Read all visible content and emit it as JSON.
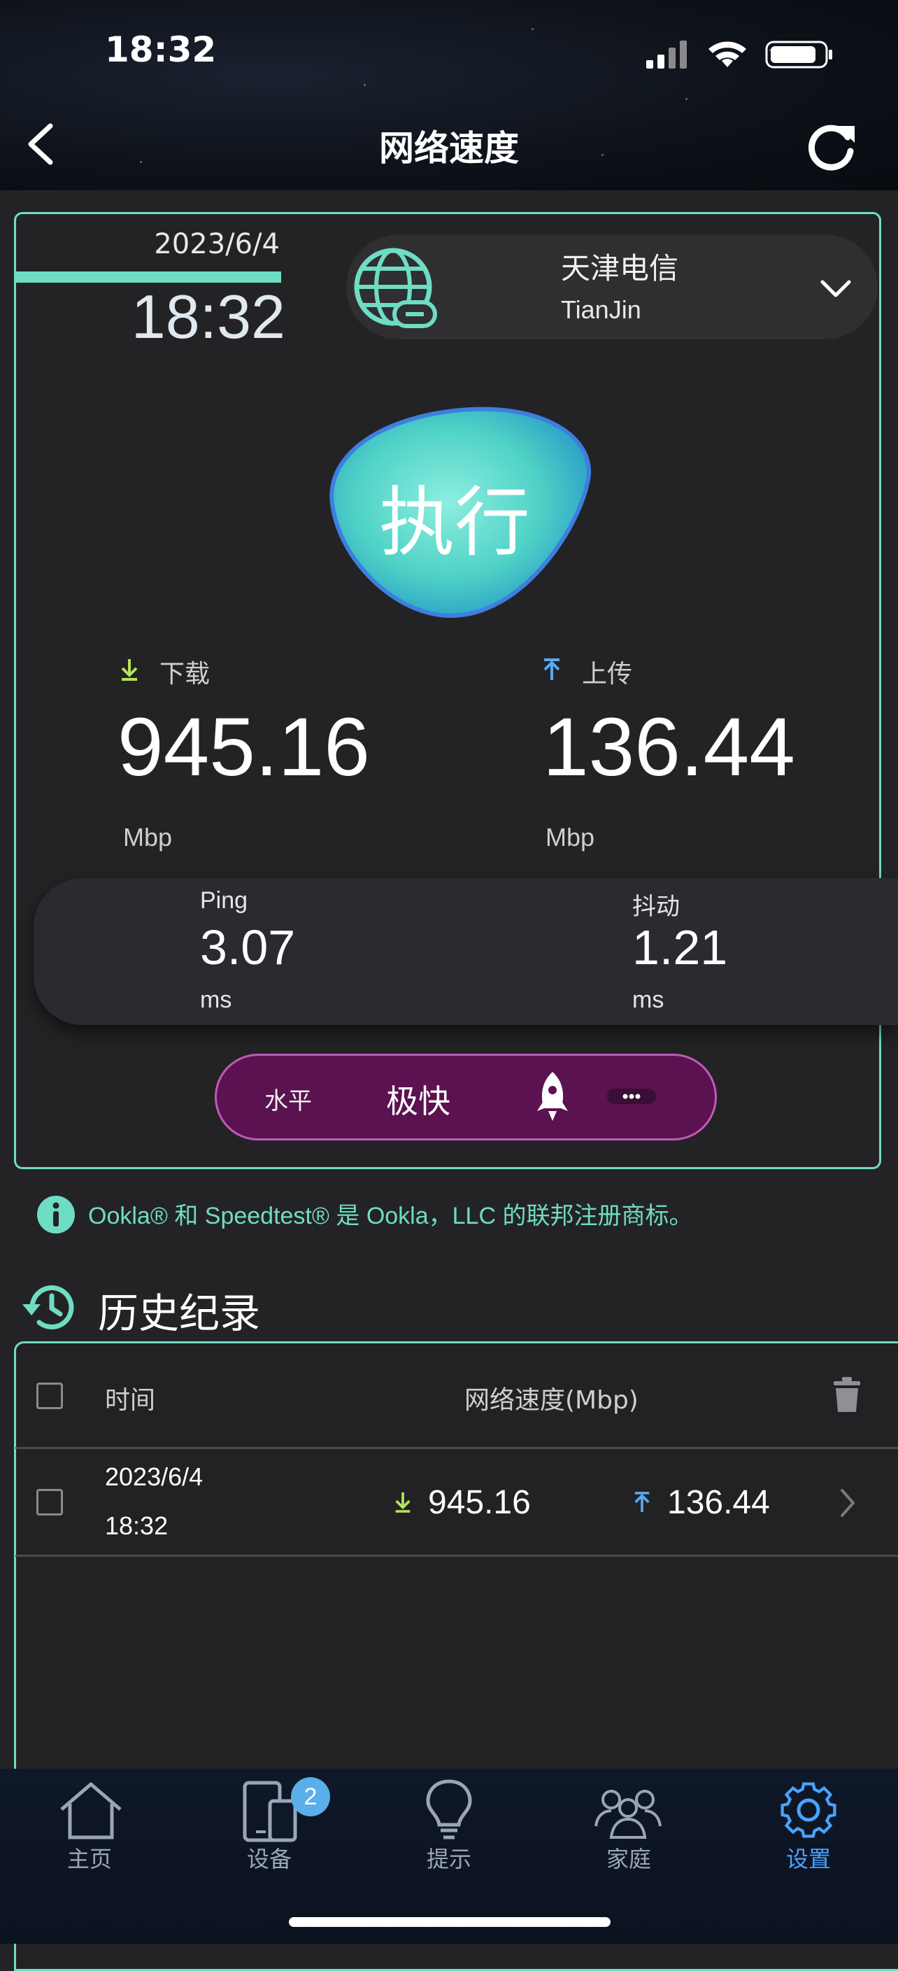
{
  "status_bar": {
    "time": "18:32"
  },
  "header": {
    "title": "网络速度"
  },
  "test": {
    "date": "2023/6/4",
    "time": "18:32",
    "server": {
      "isp": "天津电信",
      "city": "TianJin"
    },
    "run_button": "执行",
    "download": {
      "label": "下载",
      "value": "945.16",
      "unit": "Mbp"
    },
    "upload": {
      "label": "上传",
      "value": "136.44",
      "unit": "Mbp"
    },
    "ping": {
      "label": "Ping",
      "value": "3.07",
      "unit": "ms"
    },
    "jitter": {
      "label": "抖动",
      "value": "1.21",
      "unit": "ms"
    },
    "level": {
      "label": "水平",
      "value": "极快"
    }
  },
  "notice": "Ookla® 和 Speedtest® 是 Ookla，LLC 的联邦注册商标。",
  "history": {
    "title": "历史纪录",
    "columns": {
      "time": "时间",
      "speed": "网络速度(Mbp)"
    },
    "rows": [
      {
        "date": "2023/6/4",
        "time": "18:32",
        "download": "945.16",
        "upload": "136.44"
      }
    ]
  },
  "tabs": [
    {
      "label": "主页",
      "icon": "home-icon"
    },
    {
      "label": "设备",
      "icon": "devices-icon",
      "badge": "2"
    },
    {
      "label": "提示",
      "icon": "lightbulb-icon"
    },
    {
      "label": "家庭",
      "icon": "family-icon"
    },
    {
      "label": "设置",
      "icon": "gear-icon",
      "active": true
    }
  ],
  "colors": {
    "accent": "#6fdcc4",
    "level_bg": "#5a1250",
    "active_tab": "#4aa3ff"
  }
}
